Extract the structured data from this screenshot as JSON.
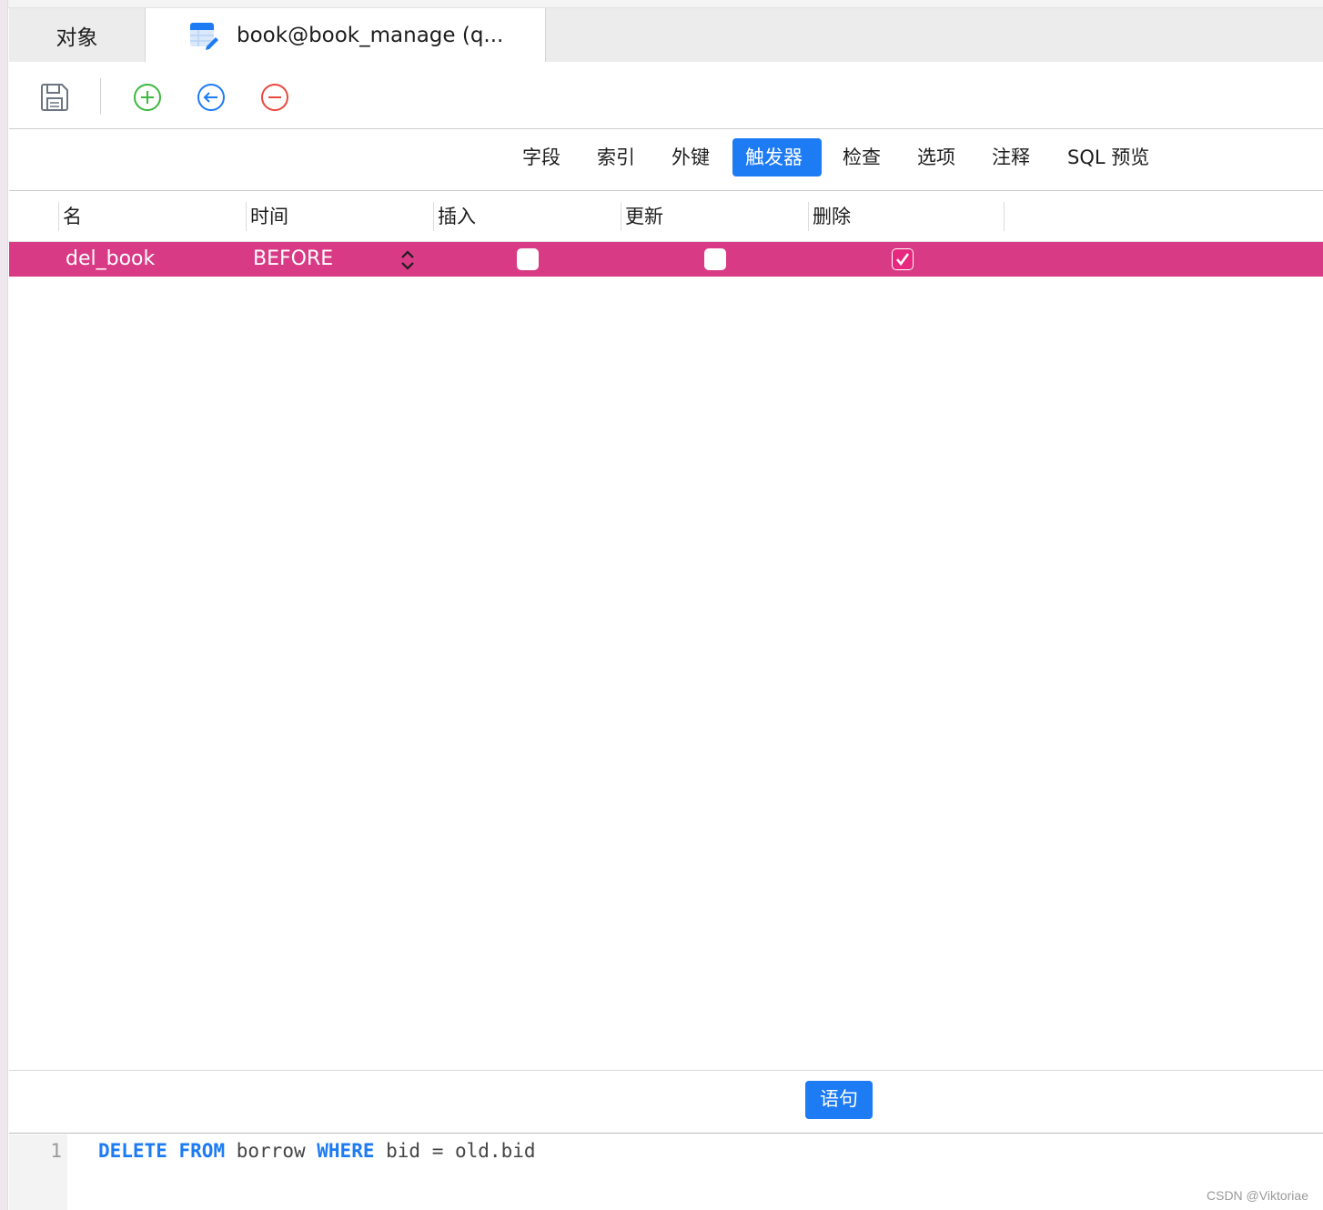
{
  "tabs": {
    "objects": "对象",
    "active": "book@book_manage (q..."
  },
  "subtabs": [
    "字段",
    "索引",
    "外键",
    "触发器",
    "检查",
    "选项",
    "注释",
    "SQL 预览"
  ],
  "active_subtab": "触发器",
  "grid": {
    "headers": [
      "名",
      "时间",
      "插入",
      "更新",
      "删除"
    ],
    "rows": [
      {
        "name": "del_book",
        "time": "BEFORE",
        "insert": false,
        "update": false,
        "delete": true
      }
    ]
  },
  "statement_button": "语句",
  "editor": {
    "line_number": "1",
    "tokens": {
      "kw1": "DELETE",
      "kw2": "FROM",
      "t1": "borrow",
      "kw3": "WHERE",
      "t2": "bid = old.bid"
    }
  },
  "watermark": "CSDN @Viktoriae",
  "colors": {
    "accent": "#1d7bf4",
    "selected_row": "#d83a85",
    "add": "#3cb83c",
    "back": "#1d7bf4",
    "remove": "#e8493f"
  }
}
